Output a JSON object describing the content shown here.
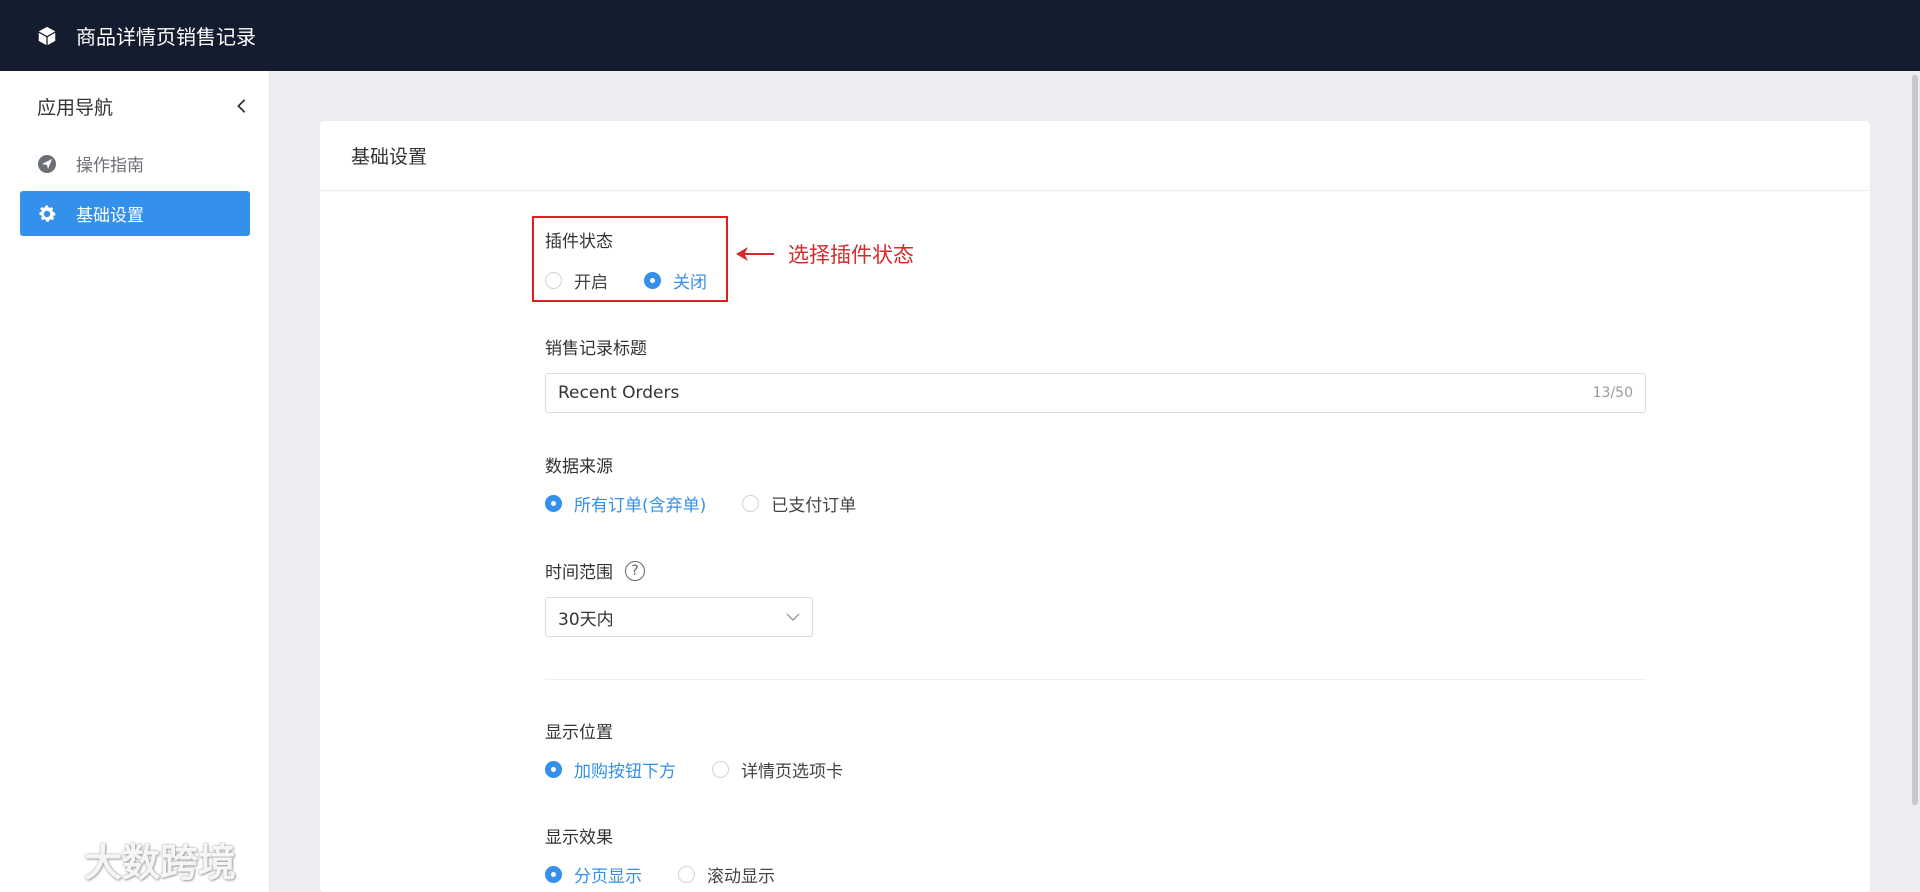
{
  "header": {
    "title": "商品详情页销售记录",
    "logo_icon": "box-icon"
  },
  "sidebar": {
    "title": "应用导航",
    "items": [
      {
        "label": "操作指南",
        "icon": "send-icon",
        "active": false
      },
      {
        "label": "基础设置",
        "icon": "gear-icon",
        "active": true
      }
    ]
  },
  "card": {
    "title": "基础设置"
  },
  "form": {
    "plugin_status": {
      "label": "插件状态",
      "options": [
        "开启",
        "关闭"
      ],
      "selected": "关闭"
    },
    "annotation": "选择插件状态",
    "sales_title": {
      "label": "销售记录标题",
      "value": "Recent Orders",
      "counter": "13/50"
    },
    "data_source": {
      "label": "数据来源",
      "options": [
        "所有订单(含弃单)",
        "已支付订单"
      ],
      "selected": "所有订单(含弃单)"
    },
    "time_range": {
      "label": "时间范围",
      "help": "?",
      "value": "30天内"
    },
    "display_position": {
      "label": "显示位置",
      "options": [
        "加购按钮下方",
        "详情页选项卡"
      ],
      "selected": "加购按钮下方"
    },
    "display_effect": {
      "label": "显示效果",
      "options": [
        "分页显示",
        "滚动显示"
      ],
      "selected": "分页显示"
    }
  },
  "watermark": "大数跨境",
  "colors": {
    "accent": "#3490ea",
    "topbar": "#141c2f",
    "annotation": "#e02020"
  }
}
